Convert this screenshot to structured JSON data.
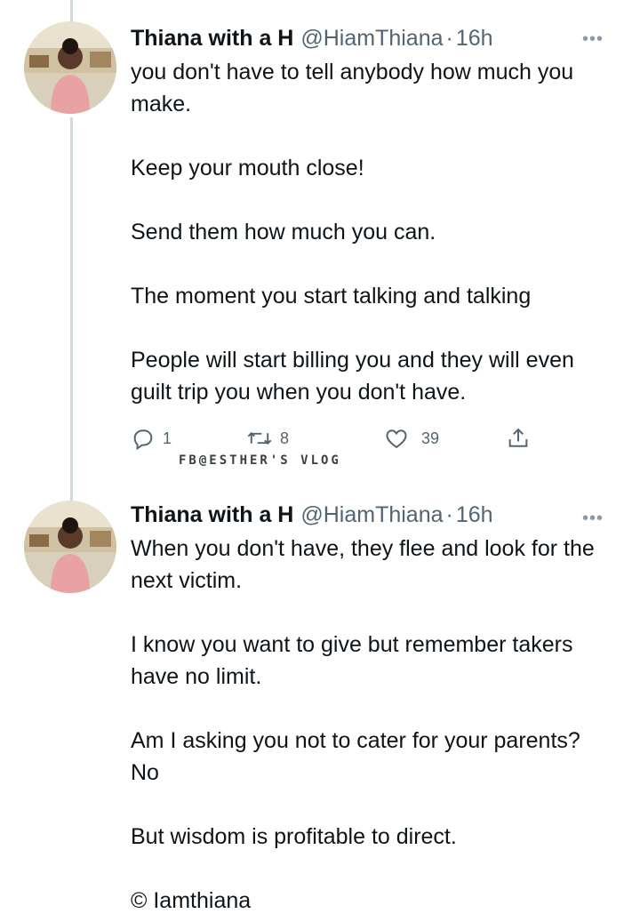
{
  "tweets": [
    {
      "display_name": "Thiana with a H",
      "handle": "@HiamThiana",
      "separator": "·",
      "time": "16h",
      "more_icon": "more-dots-icon",
      "avatar_icon": "profile-photo",
      "paragraphs": [
        "you don't have to tell anybody how much you make.",
        "Keep your mouth close!",
        "Send them how much you can.",
        "The moment you start talking and talking",
        "People will start billing you and they will even guilt trip you when you don't have."
      ],
      "actions": {
        "reply_count": "1",
        "retweet_count": "8",
        "like_count": "39"
      }
    },
    {
      "display_name": "Thiana with a H",
      "handle": "@HiamThiana",
      "separator": "·",
      "time": "16h",
      "more_icon": "more-dots-icon",
      "avatar_icon": "profile-photo",
      "paragraphs": [
        "When you don't have, they flee and look for the next victim.",
        "I know you want to give but remember takers have no limit.",
        "Am I asking you not to cater for your parents? No",
        "But wisdom is profitable to direct.",
        "© Iamthiana"
      ]
    }
  ],
  "watermark": "FB@ESTHER'S VLOG",
  "colors": {
    "text": "#0f1419",
    "secondary": "#536471",
    "thread_line": "#cfd9de"
  }
}
